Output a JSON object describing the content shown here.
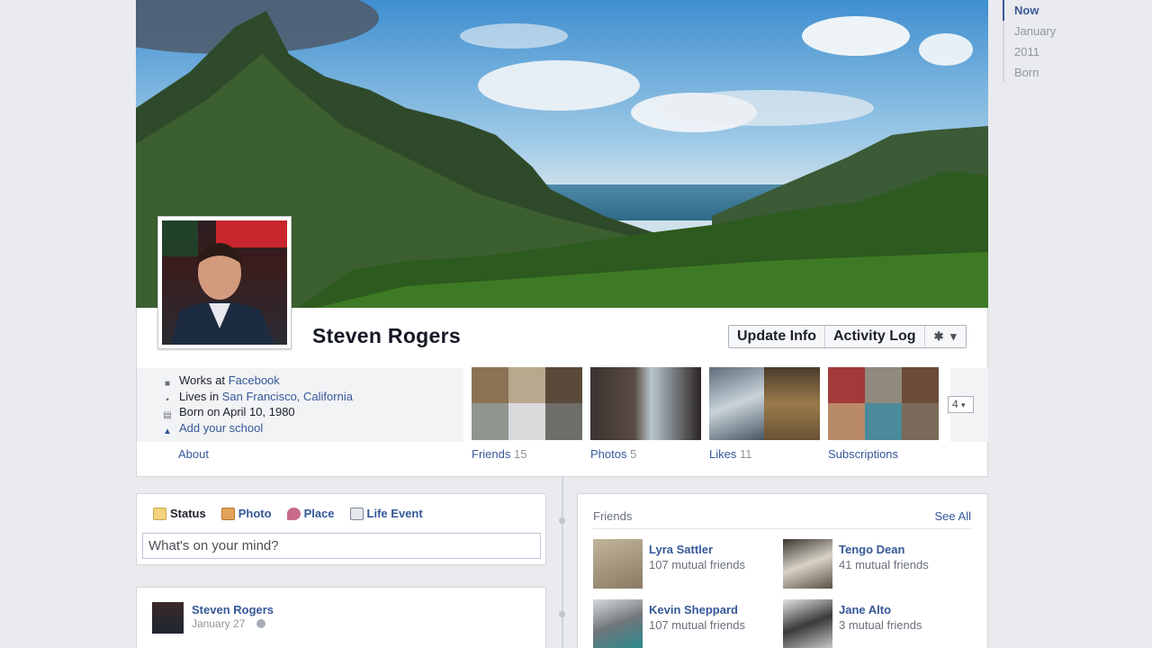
{
  "timeline_nav": [
    "Now",
    "January",
    "2011",
    "Born"
  ],
  "profile": {
    "name": "Steven Rogers"
  },
  "header_buttons": {
    "update_info": "Update Info",
    "activity_log": "Activity Log",
    "settings_icon": "gear-icon"
  },
  "about": {
    "works_prefix": "Works at ",
    "works_link": "Facebook",
    "lives_prefix": "Lives in ",
    "lives_link": "San Francisco, California",
    "born": "Born on April 10, 1980",
    "add_school": "Add your school",
    "about_link": "About"
  },
  "tiles": [
    {
      "label": "Friends",
      "count": "15"
    },
    {
      "label": "Photos",
      "count": "5"
    },
    {
      "label": "Likes",
      "count": "11"
    },
    {
      "label": "Subscriptions",
      "count": ""
    }
  ],
  "more_count": "4",
  "composer": {
    "tabs": [
      "Status",
      "Photo",
      "Place",
      "Life Event"
    ],
    "placeholder": "What's on your mind?"
  },
  "post": {
    "author": "Steven Rogers",
    "date": "January 27"
  },
  "friends_box": {
    "title": "Friends",
    "see_all": "See All",
    "friends": [
      {
        "name": "Lyra Sattler",
        "mutual": "107 mutual friends"
      },
      {
        "name": "Tengo Dean",
        "mutual": "41 mutual friends"
      },
      {
        "name": "Kevin Sheppard",
        "mutual": "107 mutual friends"
      },
      {
        "name": "Jane Alto",
        "mutual": "3 mutual friends"
      }
    ]
  },
  "colors": {
    "link": "#365899",
    "brand": "#3b5998",
    "background": "#e9ebee"
  }
}
